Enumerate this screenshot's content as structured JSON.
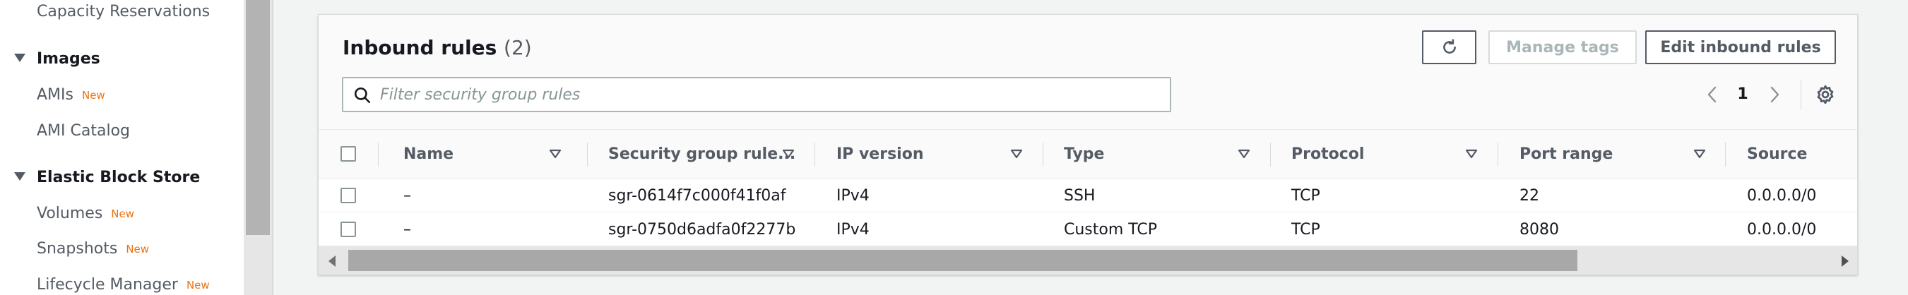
{
  "sidebar": {
    "items": [
      {
        "label": "Capacity Reservations",
        "badge": ""
      },
      {
        "label": "AMIs",
        "badge": "New"
      },
      {
        "label": "AMI Catalog",
        "badge": ""
      },
      {
        "label": "Volumes",
        "badge": "New"
      },
      {
        "label": "Snapshots",
        "badge": "New"
      },
      {
        "label": "Lifecycle Manager",
        "badge": "New"
      }
    ],
    "sections": [
      {
        "label": "Images"
      },
      {
        "label": "Elastic Block Store"
      }
    ]
  },
  "panel": {
    "title": "Inbound rules",
    "count": "(2)",
    "buttons": {
      "manage_tags": "Manage tags",
      "edit_inbound_rules": "Edit inbound rules"
    },
    "search": {
      "placeholder": "Filter security group rules",
      "value": ""
    },
    "pagination": {
      "current_page": "1"
    }
  },
  "table": {
    "columns": [
      "Name",
      "Security group rule...",
      "IP version",
      "Type",
      "Protocol",
      "Port range",
      "Source"
    ],
    "rows": [
      {
        "name": "–",
        "rule_id": "sgr-0614f7c000f41f0af",
        "ip_version": "IPv4",
        "type": "SSH",
        "protocol": "TCP",
        "port_range": "22",
        "source": "0.0.0.0/0"
      },
      {
        "name": "–",
        "rule_id": "sgr-0750d6adfa0f2277b",
        "ip_version": "IPv4",
        "type": "Custom TCP",
        "protocol": "TCP",
        "port_range": "8080",
        "source": "0.0.0.0/0"
      }
    ]
  },
  "colors": {
    "accent_new": "#ec7211",
    "text_primary": "#16191f",
    "text_secondary": "#545b64",
    "border": "#d5dbdb"
  },
  "icons": {
    "search": "search-icon",
    "refresh": "refresh-icon",
    "settings": "gear-icon",
    "prev": "chevron-left-icon",
    "next": "chevron-right-icon",
    "sort": "sort-caret-icon",
    "expand": "caret-down-icon"
  }
}
